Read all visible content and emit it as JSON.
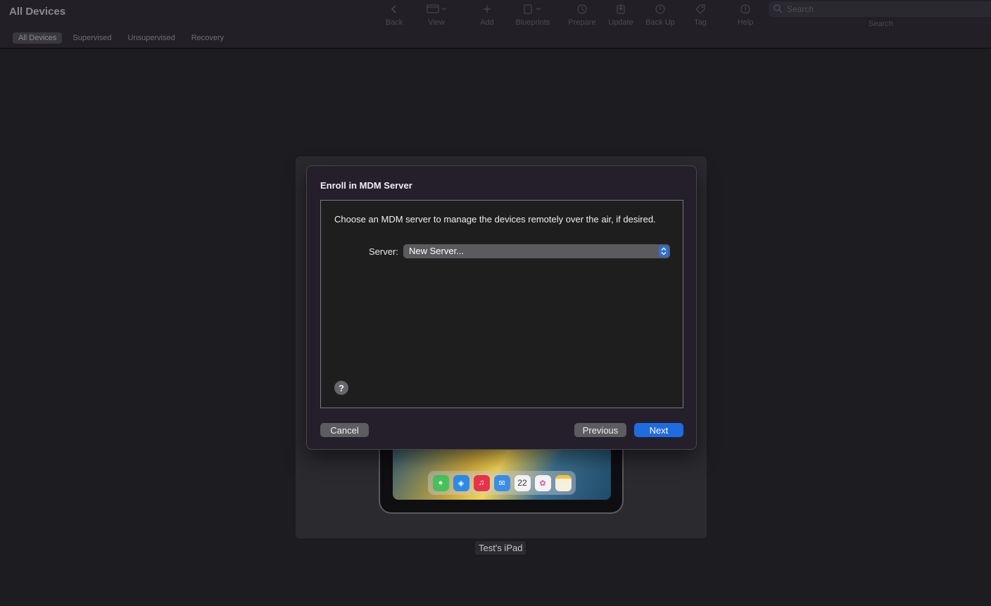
{
  "window": {
    "title": "All Devices"
  },
  "filters": [
    "All Devices",
    "Supervised",
    "Unsupervised",
    "Recovery"
  ],
  "toolbar": {
    "items": [
      {
        "label": "Back",
        "icon": "chevron-left-icon"
      },
      {
        "label": "View",
        "icon": "view-icon"
      },
      {
        "label": "Add",
        "icon": "plus-icon"
      },
      {
        "label": "Blueprints",
        "icon": "blueprints-icon"
      },
      {
        "label": "Prepare",
        "icon": "prepare-icon"
      },
      {
        "label": "Update",
        "icon": "update-icon"
      },
      {
        "label": "Back Up",
        "icon": "backup-icon"
      },
      {
        "label": "Tag",
        "icon": "tag-icon"
      },
      {
        "label": "Help",
        "icon": "help-icon"
      }
    ],
    "search_placeholder": "Search",
    "search_label": "Search"
  },
  "device": {
    "name": "Test's iPad",
    "calendar_day": "22"
  },
  "dialog": {
    "title": "Enroll in MDM Server",
    "instructions": "Choose an MDM server to manage the devices remotely over the air, if desired.",
    "server_label": "Server:",
    "server_value": "New Server...",
    "help_glyph": "?",
    "cancel": "Cancel",
    "previous": "Previous",
    "next": "Next"
  },
  "colors": {
    "accent": "#1f6ce0",
    "background": "#1d1c21",
    "sheet": "#241f2b"
  }
}
